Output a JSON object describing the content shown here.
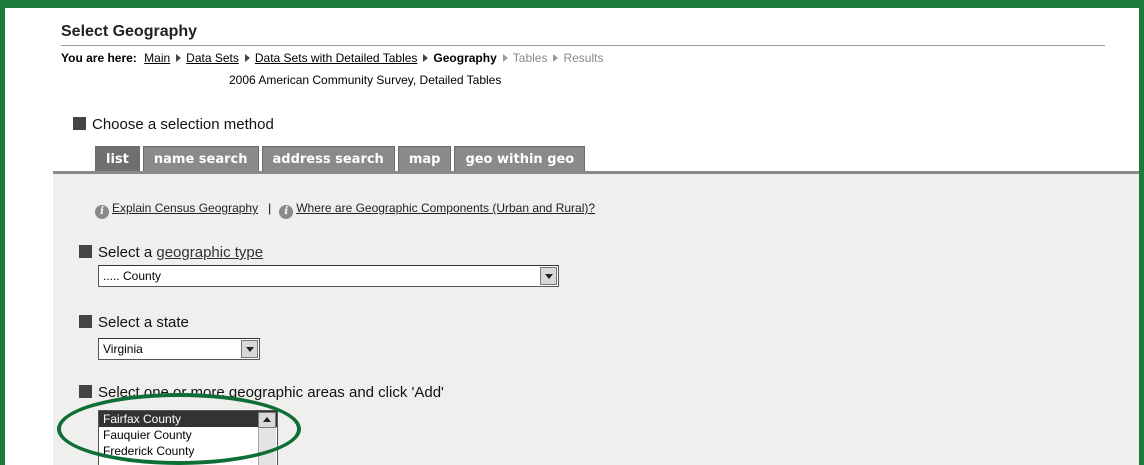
{
  "page": {
    "title": "Select Geography"
  },
  "breadcrumb": {
    "lead": "You are here:",
    "links": [
      "Main",
      "Data Sets",
      "Data Sets with Detailed Tables"
    ],
    "current": "Geography",
    "future": [
      "Tables",
      "Results"
    ],
    "dataset": "2006 American Community Survey, Detailed Tables"
  },
  "method": {
    "label": "Choose a selection method",
    "tabs": [
      "list",
      "name search",
      "address search",
      "map",
      "geo within geo"
    ],
    "active_tab": "list"
  },
  "help": {
    "link1": "Explain Census Geography",
    "separator": "|",
    "link2": "Where are Geographic Components (Urban and Rural)?"
  },
  "geo_type": {
    "label_prefix": "Select a",
    "label_link": "geographic type",
    "value": "..... County"
  },
  "state": {
    "label": "Select a state",
    "value": "Virginia"
  },
  "areas": {
    "label": "Select one or more geographic areas and click 'Add'",
    "options": [
      "Fairfax County",
      "Fauquier County",
      "Frederick County"
    ],
    "selected": "Fairfax County"
  },
  "colors": {
    "frame": "#1e7a3c",
    "oval": "#0d6e36",
    "tab": "#8a8a8a",
    "panel": "#eff0ee"
  }
}
